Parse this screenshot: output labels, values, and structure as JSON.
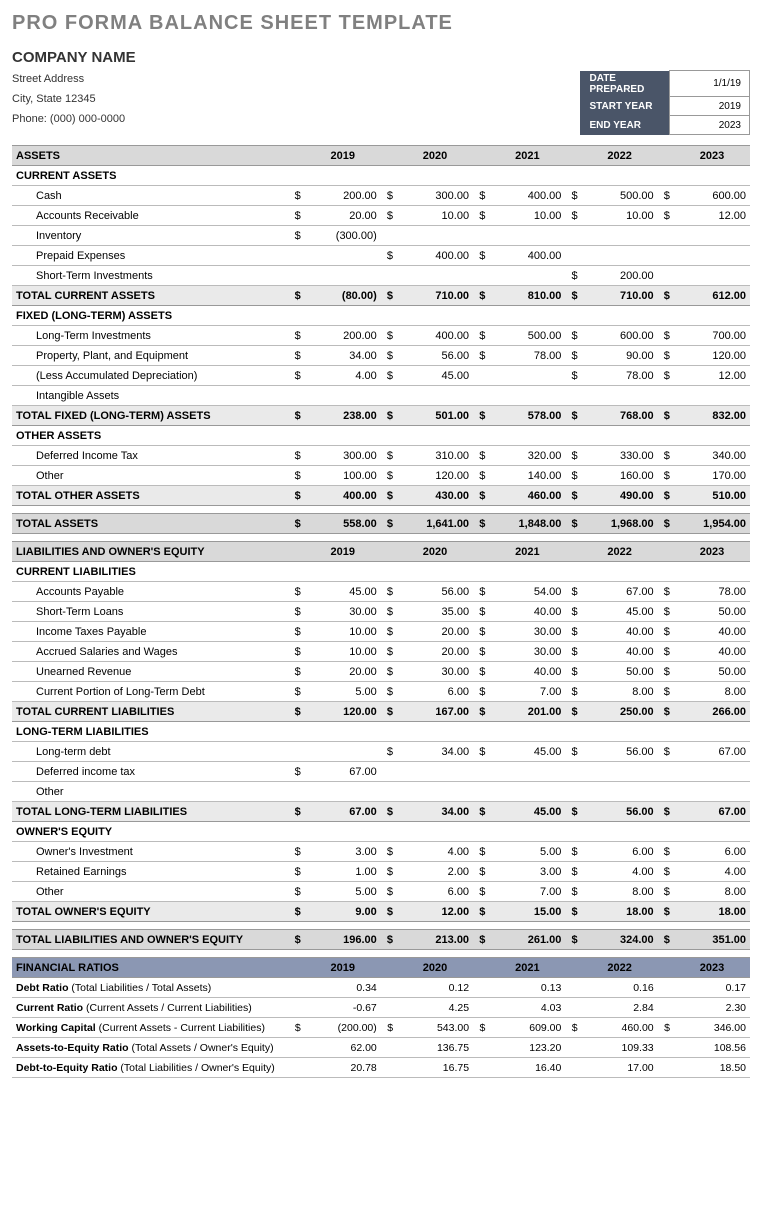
{
  "title": "PRO FORMA BALANCE SHEET TEMPLATE",
  "company": "COMPANY NAME",
  "address": {
    "street": "Street Address",
    "city": "City, State  12345",
    "phone": "Phone: (000) 000-0000"
  },
  "meta": {
    "date_label": "DATE PREPARED",
    "date": "1/1/19",
    "start_label": "START YEAR",
    "start": "2019",
    "end_label": "END YEAR",
    "end": "2023"
  },
  "years": [
    "2019",
    "2020",
    "2021",
    "2022",
    "2023"
  ],
  "assets_header": "ASSETS",
  "current_assets": {
    "header": "CURRENT ASSETS",
    "rows": [
      {
        "label": "Cash",
        "v": [
          "200.00",
          "300.00",
          "400.00",
          "500.00",
          "600.00"
        ]
      },
      {
        "label": "Accounts Receivable",
        "v": [
          "20.00",
          "10.00",
          "10.00",
          "10.00",
          "12.00"
        ]
      },
      {
        "label": "Inventory",
        "v": [
          "(300.00)",
          "",
          "",
          "",
          ""
        ]
      },
      {
        "label": "Prepaid Expenses",
        "v": [
          "",
          "400.00",
          "400.00",
          "",
          ""
        ]
      },
      {
        "label": "Short-Term Investments",
        "v": [
          "",
          "",
          "",
          "200.00",
          ""
        ]
      }
    ],
    "total_label": "TOTAL CURRENT ASSETS",
    "total": [
      "(80.00)",
      "710.00",
      "810.00",
      "710.00",
      "612.00"
    ]
  },
  "fixed_assets": {
    "header": "FIXED (LONG-TERM) ASSETS",
    "rows": [
      {
        "label": "Long-Term Investments",
        "v": [
          "200.00",
          "400.00",
          "500.00",
          "600.00",
          "700.00"
        ]
      },
      {
        "label": "Property, Plant, and Equipment",
        "v": [
          "34.00",
          "56.00",
          "78.00",
          "90.00",
          "120.00"
        ]
      },
      {
        "label": "(Less Accumulated Depreciation)",
        "v": [
          "4.00",
          "45.00",
          "",
          "78.00",
          "12.00"
        ]
      },
      {
        "label": "Intangible Assets",
        "v": [
          "",
          "",
          "",
          "",
          ""
        ]
      }
    ],
    "total_label": "TOTAL FIXED (LONG-TERM) ASSETS",
    "total": [
      "238.00",
      "501.00",
      "578.00",
      "768.00",
      "832.00"
    ]
  },
  "other_assets": {
    "header": "OTHER ASSETS",
    "rows": [
      {
        "label": "Deferred Income Tax",
        "v": [
          "300.00",
          "310.00",
          "320.00",
          "330.00",
          "340.00"
        ]
      },
      {
        "label": "Other",
        "v": [
          "100.00",
          "120.00",
          "140.00",
          "160.00",
          "170.00"
        ]
      }
    ],
    "total_label": "TOTAL OTHER ASSETS",
    "total": [
      "400.00",
      "430.00",
      "460.00",
      "490.00",
      "510.00"
    ]
  },
  "total_assets": {
    "label": "TOTAL ASSETS",
    "v": [
      "558.00",
      "1,641.00",
      "1,848.00",
      "1,968.00",
      "1,954.00"
    ]
  },
  "liab_header": "LIABILITIES AND OWNER'S EQUITY",
  "current_liab": {
    "header": "CURRENT LIABILITIES",
    "rows": [
      {
        "label": "Accounts Payable",
        "v": [
          "45.00",
          "56.00",
          "54.00",
          "67.00",
          "78.00"
        ]
      },
      {
        "label": "Short-Term Loans",
        "v": [
          "30.00",
          "35.00",
          "40.00",
          "45.00",
          "50.00"
        ]
      },
      {
        "label": "Income Taxes Payable",
        "v": [
          "10.00",
          "20.00",
          "30.00",
          "40.00",
          "40.00"
        ]
      },
      {
        "label": "Accrued Salaries and Wages",
        "v": [
          "10.00",
          "20.00",
          "30.00",
          "40.00",
          "40.00"
        ]
      },
      {
        "label": "Unearned Revenue",
        "v": [
          "20.00",
          "30.00",
          "40.00",
          "50.00",
          "50.00"
        ]
      },
      {
        "label": "Current Portion of Long-Term Debt",
        "v": [
          "5.00",
          "6.00",
          "7.00",
          "8.00",
          "8.00"
        ]
      }
    ],
    "total_label": "TOTAL CURRENT LIABILITIES",
    "total": [
      "120.00",
      "167.00",
      "201.00",
      "250.00",
      "266.00"
    ]
  },
  "long_liab": {
    "header": "LONG-TERM LIABILITIES",
    "rows": [
      {
        "label": "Long-term debt",
        "v": [
          "",
          "34.00",
          "45.00",
          "56.00",
          "67.00"
        ]
      },
      {
        "label": "Deferred income tax",
        "v": [
          "67.00",
          "",
          "",
          "",
          ""
        ]
      },
      {
        "label": "Other",
        "v": [
          "",
          "",
          "",
          "",
          ""
        ]
      }
    ],
    "total_label": "TOTAL LONG-TERM LIABILITIES",
    "total": [
      "67.00",
      "34.00",
      "45.00",
      "56.00",
      "67.00"
    ]
  },
  "equity": {
    "header": "OWNER'S EQUITY",
    "rows": [
      {
        "label": "Owner's Investment",
        "v": [
          "3.00",
          "4.00",
          "5.00",
          "6.00",
          "6.00"
        ]
      },
      {
        "label": "Retained Earnings",
        "v": [
          "1.00",
          "2.00",
          "3.00",
          "4.00",
          "4.00"
        ]
      },
      {
        "label": "Other",
        "v": [
          "5.00",
          "6.00",
          "7.00",
          "8.00",
          "8.00"
        ]
      }
    ],
    "total_label": "TOTAL OWNER'S EQUITY",
    "total": [
      "9.00",
      "12.00",
      "15.00",
      "18.00",
      "18.00"
    ]
  },
  "total_liab_eq": {
    "label": "TOTAL LIABILITIES AND OWNER'S EQUITY",
    "v": [
      "196.00",
      "213.00",
      "261.00",
      "324.00",
      "351.00"
    ]
  },
  "ratios_header": "FINANCIAL RATIOS",
  "ratios": [
    {
      "bold": "Debt Ratio",
      "paren": "(Total Liabilities / Total Assets)",
      "sym": [
        "",
        "",
        "",
        "",
        ""
      ],
      "v": [
        "0.34",
        "0.12",
        "0.13",
        "0.16",
        "0.17"
      ]
    },
    {
      "bold": "Current Ratio",
      "paren": "(Current Assets / Current Liabilities)",
      "sym": [
        "",
        "",
        "",
        "",
        ""
      ],
      "v": [
        "-0.67",
        "4.25",
        "4.03",
        "2.84",
        "2.30"
      ]
    },
    {
      "bold": "Working Capital",
      "paren": "(Current Assets - Current Liabilities)",
      "sym": [
        "$",
        "$",
        "$",
        "$",
        "$"
      ],
      "v": [
        "(200.00)",
        "543.00",
        "609.00",
        "460.00",
        "346.00"
      ]
    },
    {
      "bold": "Assets-to-Equity Ratio",
      "paren": "(Total Assets / Owner's Equity)",
      "sym": [
        "",
        "",
        "",
        "",
        ""
      ],
      "v": [
        "62.00",
        "136.75",
        "123.20",
        "109.33",
        "108.56"
      ]
    },
    {
      "bold": "Debt-to-Equity Ratio",
      "paren": "(Total Liabilities / Owner's Equity)",
      "sym": [
        "",
        "",
        "",
        "",
        ""
      ],
      "v": [
        "20.78",
        "16.75",
        "16.40",
        "17.00",
        "18.50"
      ]
    }
  ]
}
